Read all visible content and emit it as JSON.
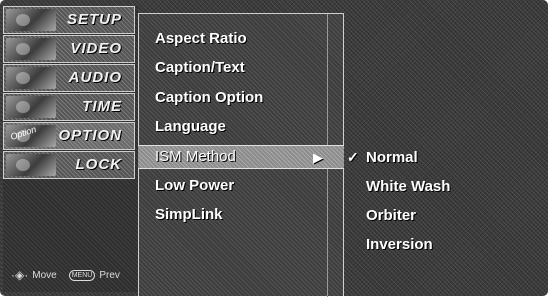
{
  "sidebar": {
    "items": [
      {
        "label": "SETUP",
        "icon": "setup-icon"
      },
      {
        "label": "VIDEO",
        "icon": "video-icon"
      },
      {
        "label": "AUDIO",
        "icon": "audio-icon"
      },
      {
        "label": "TIME",
        "icon": "time-icon"
      },
      {
        "label": "OPTION",
        "icon": "option-icon",
        "active": true,
        "badge": "Option"
      },
      {
        "label": "LOCK",
        "icon": "lock-icon"
      }
    ],
    "footer": {
      "move_label": "Move",
      "menu_key": "MENU",
      "prev_label": "Prev"
    }
  },
  "menu": {
    "items": [
      "Aspect Ratio",
      "Caption/Text",
      "Caption Option",
      "Language",
      "ISM Method",
      "Low Power",
      "SimpLink"
    ],
    "selected_index": 4
  },
  "submenu": {
    "items": [
      "Normal",
      "White Wash",
      "Orbiter",
      "Inversion"
    ],
    "checked_index": 0
  },
  "colors": {
    "background": "#3a3a3a",
    "highlight": "#8c8c8c",
    "text": "#ffffff"
  }
}
